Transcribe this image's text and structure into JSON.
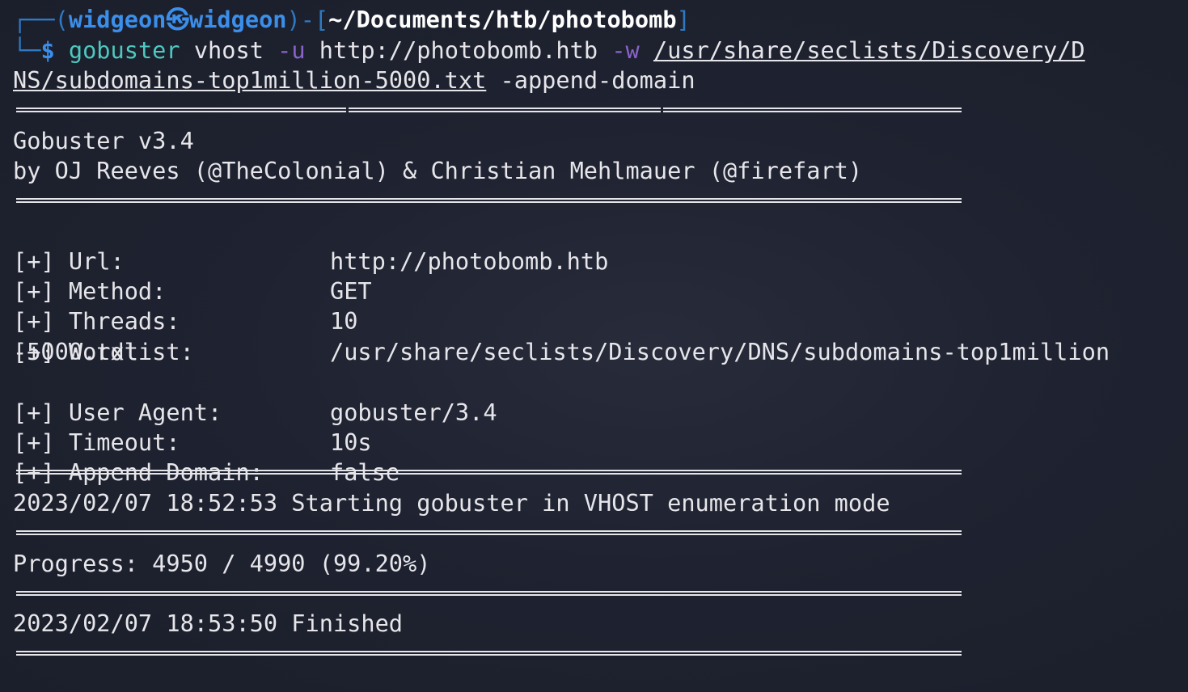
{
  "prompt": {
    "user": "widgeon",
    "at_symbol": "㉿",
    "host": "widgeon",
    "path": "~/Documents/htb/photobomb",
    "dollar": "$"
  },
  "command": {
    "name": "gobuster",
    "subcommand": "vhost",
    "flag_u": "-u",
    "url": "http://photobomb.htb",
    "flag_w": "-w",
    "wordlist_part1": "/usr/share/seclists/Discovery/D",
    "wordlist_part2": "NS/subdomains-top1million-5000.txt",
    "extra": "-append-domain"
  },
  "banner": {
    "version": "Gobuster v3.4",
    "authors": "by OJ Reeves (@TheColonial) & Christian Mehlmauer (@firefart)"
  },
  "config": [
    {
      "key": "[+] Url:",
      "value": "http://photobomb.htb"
    },
    {
      "key": "[+] Method:",
      "value": "GET"
    },
    {
      "key": "[+] Threads:",
      "value": "10"
    },
    {
      "key": "[+] Wordlist:",
      "value": "/usr/share/seclists/Discovery/DNS/subdomains-top1million",
      "value_cont": "-5000.txt"
    },
    {
      "key": "[+] User Agent:",
      "value": "gobuster/3.4"
    },
    {
      "key": "[+] Timeout:",
      "value": "10s"
    },
    {
      "key": "[+] Append Domain:",
      "value": "false"
    }
  ],
  "status": {
    "start": "2023/02/07 18:52:53 Starting gobuster in VHOST enumeration mode",
    "progress": "Progress: 4950 / 4990 (99.20%)",
    "finished": "2023/02/07 18:53:50 Finished"
  },
  "colors": {
    "background": "#1e2230",
    "text": "#e6e6ea",
    "prompt_blue": "#3b8eea",
    "command_cyan": "#4ec8c0",
    "flag_purple": "#8a63c9"
  }
}
